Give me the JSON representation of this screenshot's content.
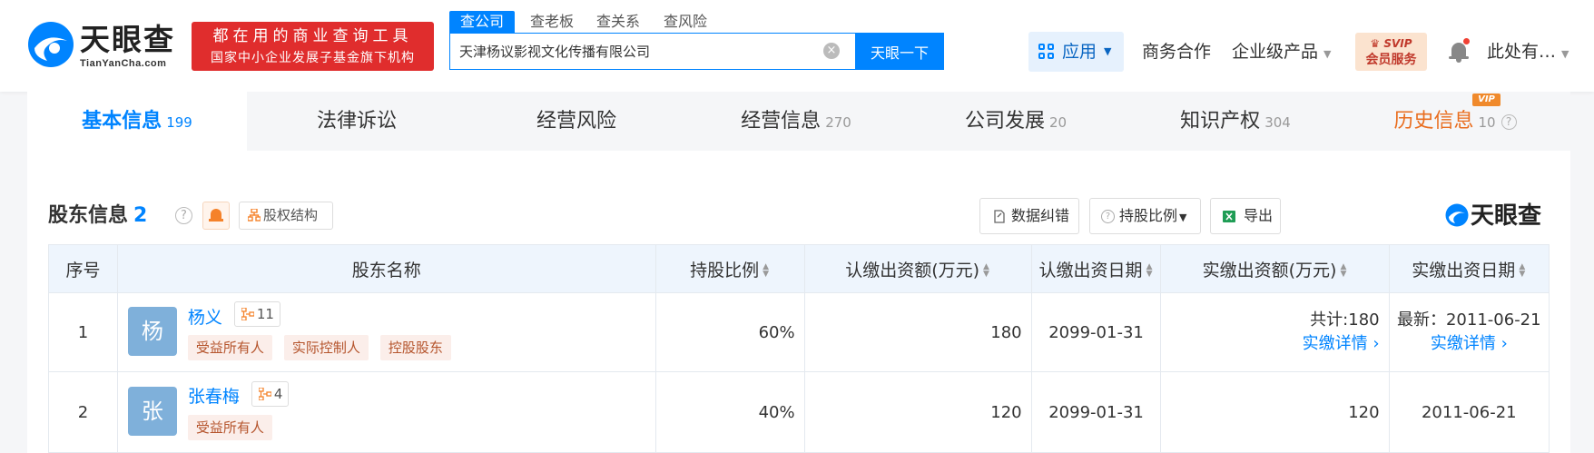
{
  "header": {
    "logo_text": "天眼查",
    "logo_domain": "TianYanCha.com",
    "slogan_line1": "都在用的商业查询工具",
    "slogan_line2": "国家中小企业发展子基金旗下机构",
    "search_tabs": [
      "查公司",
      "查老板",
      "查关系",
      "查风险"
    ],
    "search_value": "天津杨议影视文化传播有限公司",
    "search_button": "天眼一下",
    "app_label": "应用",
    "nav": [
      "商务合作",
      "企业级产品"
    ],
    "vip_line1": "SVIP",
    "vip_line2": "会员服务",
    "user_name": "此处有…"
  },
  "tabs": [
    {
      "label": "基本信息",
      "count": "199"
    },
    {
      "label": "法律诉讼",
      "count": ""
    },
    {
      "label": "经营风险",
      "count": ""
    },
    {
      "label": "经营信息",
      "count": "270"
    },
    {
      "label": "公司发展",
      "count": "20"
    },
    {
      "label": "知识产权",
      "count": "304"
    },
    {
      "label": "历史信息",
      "count": "10"
    }
  ],
  "vip_tag": "VIP",
  "section": {
    "title": "股东信息",
    "count": "2",
    "structure_button": "股权结构",
    "correct_button": "数据纠错",
    "ratio_button": "持股比例",
    "export_button": "导出",
    "brand": "天眼查"
  },
  "table": {
    "headers": [
      "序号",
      "股东名称",
      "持股比例",
      "认缴出资额(万元)",
      "认缴出资日期",
      "实缴出资额(万元)",
      "实缴出资日期"
    ],
    "rows": [
      {
        "index": "1",
        "avatar": "杨",
        "name": "杨义",
        "relations": "11",
        "tags": [
          "受益所有人",
          "实际控制人",
          "控股股东"
        ],
        "ratio": "60%",
        "subscribed": "180",
        "subscribed_date": "2099-01-31",
        "paid_total": "共计:180",
        "paid_detail": "实缴详情",
        "paid_date": "最新：2011-06-21",
        "paid_date_detail": "实缴详情"
      },
      {
        "index": "2",
        "avatar": "张",
        "name": "张春梅",
        "relations": "4",
        "tags": [
          "受益所有人"
        ],
        "ratio": "40%",
        "subscribed": "120",
        "subscribed_date": "2099-01-31",
        "paid_total": "120",
        "paid_date": "2011-06-21"
      }
    ]
  }
}
